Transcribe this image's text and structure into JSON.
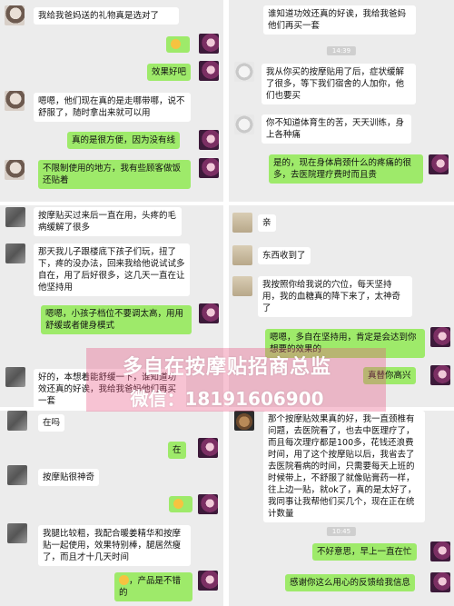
{
  "panel1": {
    "messages": [
      {
        "side": "in",
        "text": "我给我爸妈送的礼物真是选对了"
      },
      {
        "side": "out",
        "text": ""
      },
      {
        "side": "out",
        "text": "效果好吧"
      },
      {
        "side": "in",
        "text": "嗯嗯，他们现在真的是走哪带哪，说不舒服了，随时拿出来就可以用"
      },
      {
        "side": "out",
        "text": "真的是很方便，因为没有线"
      },
      {
        "side": "in",
        "text": "不限制使用的地方，我有些顾客做饭还贴着"
      }
    ]
  },
  "panel2": {
    "top_text": "谁知道功效还真的好诶，我给我爸妈他们再买一套",
    "time": "14:39",
    "messages": [
      {
        "side": "in",
        "text": "我从你买的按摩贴用了后，症状缓解了很多，等下我们宿舍的人加你，他们也要买"
      },
      {
        "side": "in",
        "text": "你不知道体育生的苦，天天训练，身上各种痛"
      },
      {
        "side": "out",
        "text": "是的，现在身体肩颈什么的疼痛的很多，去医院理疗费时而且贵"
      }
    ]
  },
  "panel3": {
    "messages": [
      {
        "side": "in",
        "text": "按摩贴买过来后一直在用，头疼的毛病缓解了很多"
      },
      {
        "side": "in",
        "text": "那天我儿子跟楼底下孩子们玩，扭了下，疼的没办法，回来我给他说试试多自在，用了后好很多，这几天一直在让他坚持用"
      },
      {
        "side": "out",
        "text": "嗯嗯，小孩子档位不要调太高，用用舒缓或者健身模式"
      },
      {
        "side": "in",
        "text": "好的，本想着能舒缓一下，谁知道功效还真的好诶，我给我爸妈他们再买一套"
      }
    ]
  },
  "panel4": {
    "messages": [
      {
        "side": "in",
        "text": "亲"
      },
      {
        "side": "in",
        "text": "东西收到了"
      },
      {
        "side": "in",
        "text": "我按照你给我说的穴位，每天坚持用，我的血糖真的降下来了，太神奇了"
      },
      {
        "side": "out",
        "text": "嗯嗯，多自在坚持用，肯定是会达到你想要的效果的"
      },
      {
        "side": "out",
        "text": "真替你高兴"
      }
    ]
  },
  "panel5": {
    "messages": [
      {
        "side": "in",
        "text": "在吗"
      },
      {
        "side": "out",
        "text": "在"
      },
      {
        "side": "in",
        "text": "按摩贴很神奇"
      },
      {
        "side": "out",
        "text": ""
      },
      {
        "side": "in",
        "text": "我腿比较粗，我配合暖姜精华和按摩贴一起使用，效果特别棒，腿居然瘦了，而且才十几天时间"
      },
      {
        "side": "out",
        "text": "，产品是不错的"
      }
    ]
  },
  "panel6": {
    "messages": [
      {
        "side": "in",
        "text": "那个按摩贴效果真的好，我一直颈椎有问题，去医院看了，也去中医理疗了，而且每次理疗都是100多，花钱还浪费时间，用了这个按摩贴以后，我省去了去医院看病的时间，只需要每天上班的时候带上，不舒服了就像贴膏药一样，往上边一贴，就ok了，真的是太好了，我同事让我帮他们买几个，现在正在统计数量"
      }
    ],
    "time": "10:45",
    "out_messages": [
      {
        "text": "不好意思，早上一直在忙"
      },
      {
        "text": "感谢你这么用心的反馈给我信息"
      }
    ]
  },
  "watermark": {
    "line1": "多自在按摩贴招商总监",
    "line2": "微信：18191606900"
  },
  "colors": {
    "bg": "#ececec",
    "bubble_in": "#ffffff",
    "bubble_out": "#9eea6a",
    "watermark_overlay": "#e75480"
  }
}
